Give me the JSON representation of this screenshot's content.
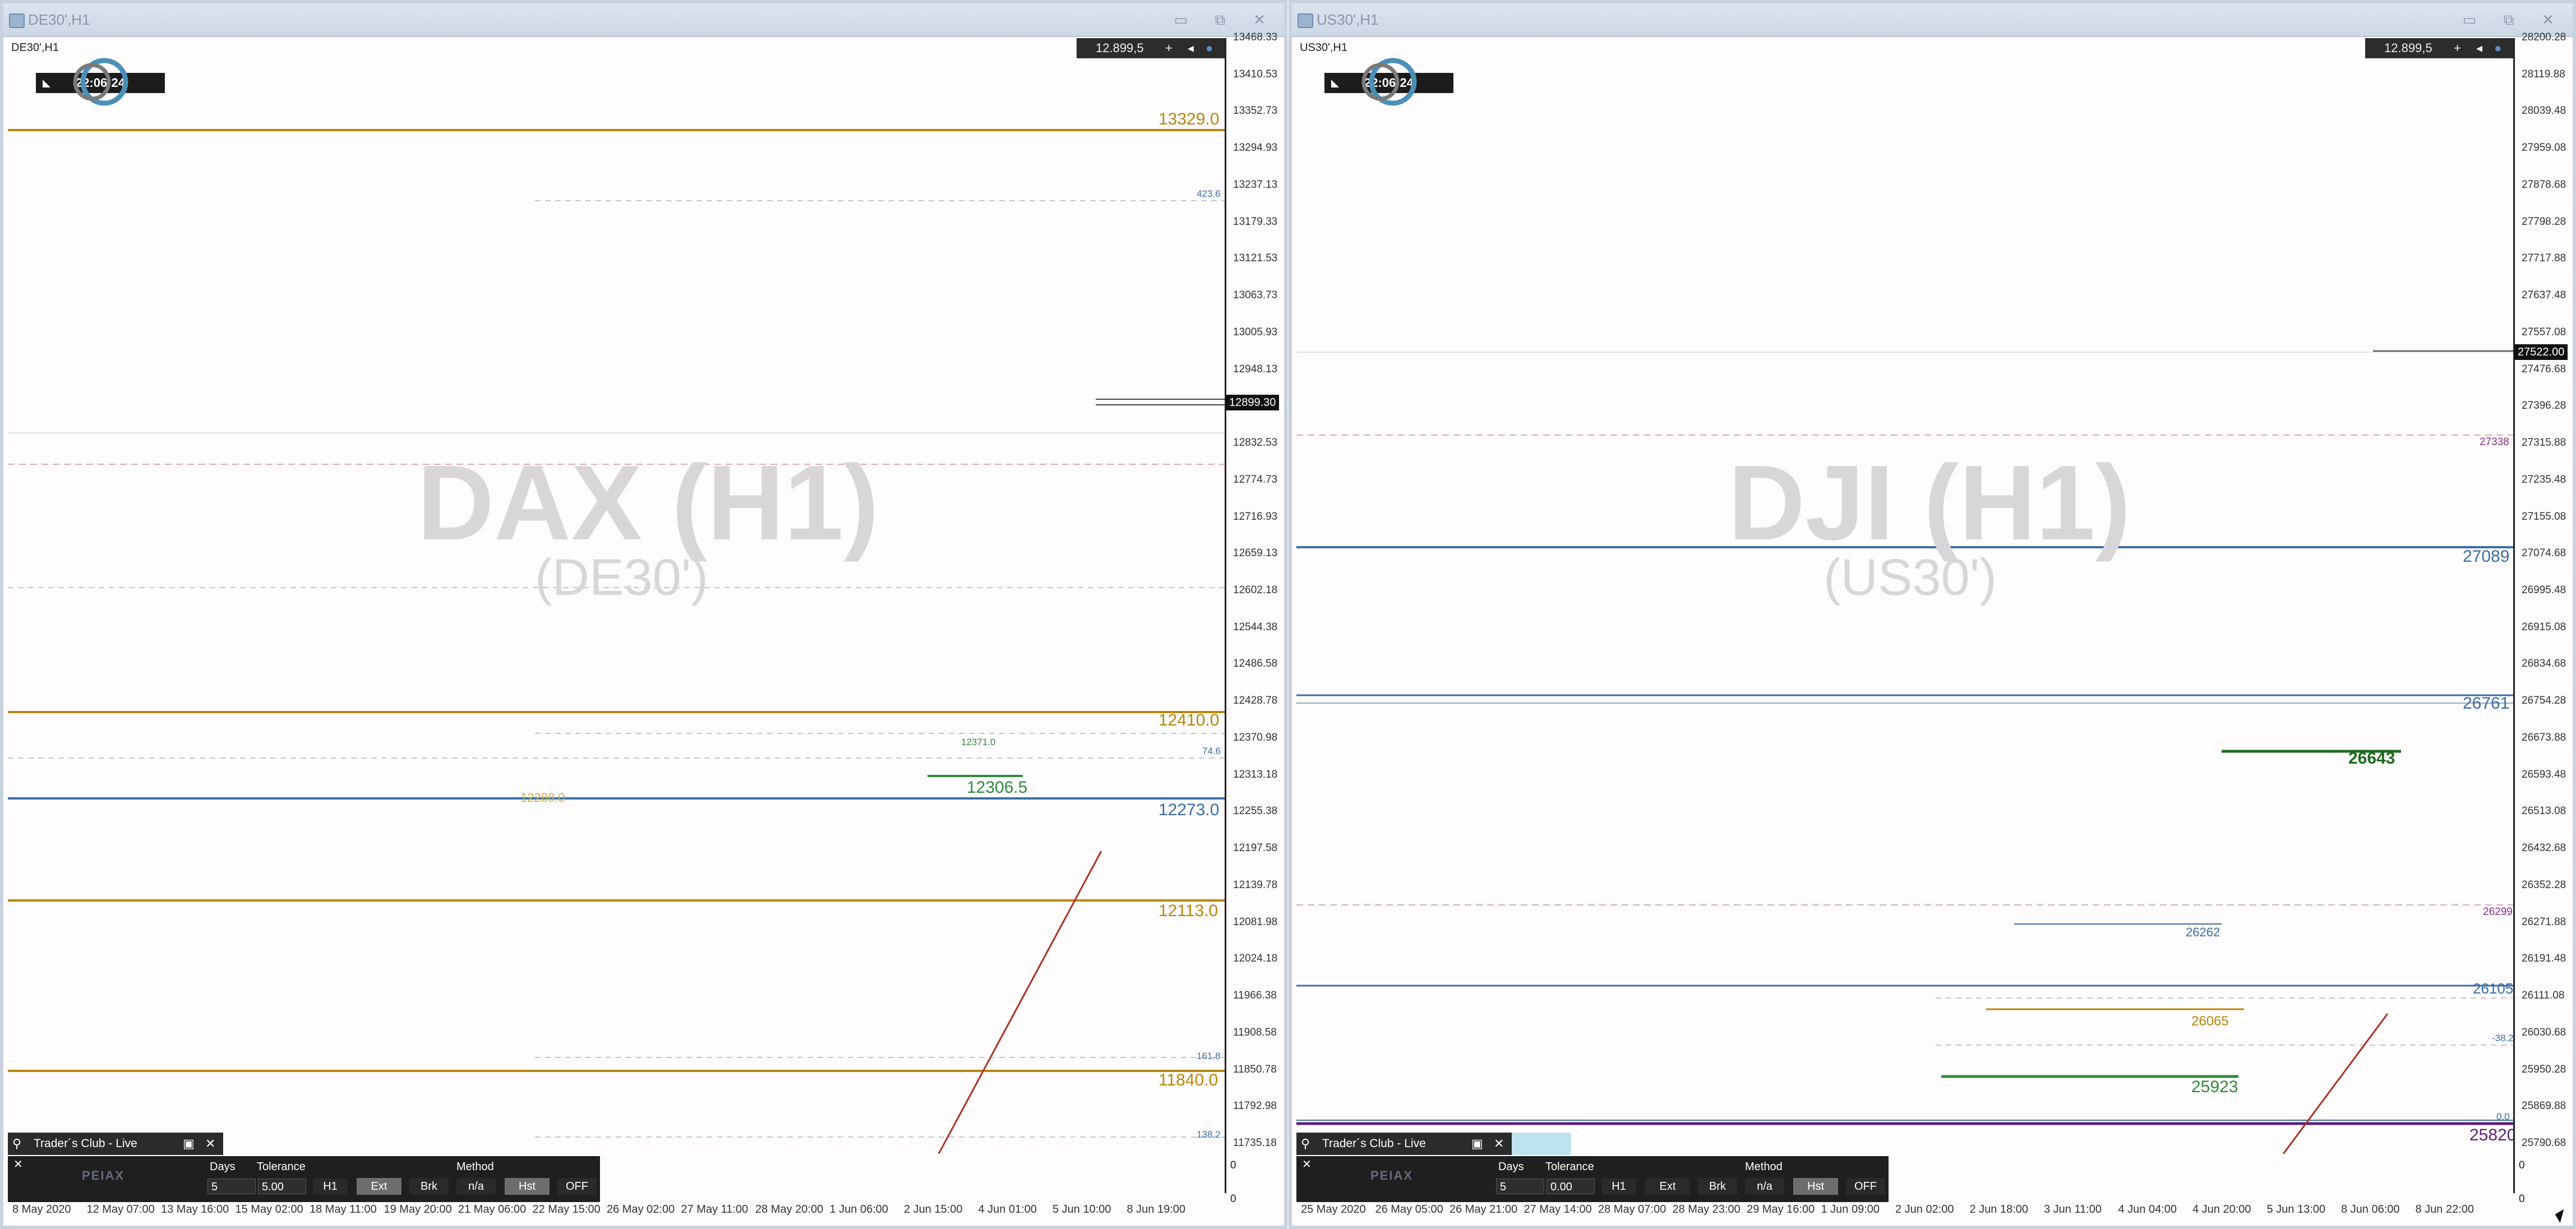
{
  "left": {
    "window_title": "DE30',H1",
    "symbol_label": "DE30',H1",
    "clock": "22:06:24",
    "top_price": "12.899,5",
    "watermark_main": "DAX (H1)",
    "watermark_sub": "(DE30')",
    "current_price": "12899.30",
    "y_ticks": [
      "13468.33",
      "13410.53",
      "13352.73",
      "13294.93",
      "13237.13",
      "13179.33",
      "13121.53",
      "13063.73",
      "13005.93",
      "12948.13",
      "12890.33",
      "12832.53",
      "12774.73",
      "12716.93",
      "12659.13",
      "12602.18",
      "12544.38",
      "12486.58",
      "12428.78",
      "12370.98",
      "12313.18",
      "12255.38",
      "12197.58",
      "12139.78",
      "12081.98",
      "12024.18",
      "11966.38",
      "11908.58",
      "11850.78",
      "11792.98",
      "11735.18"
    ],
    "levels": [
      {
        "label": "13329.0",
        "color": "#b8860b"
      },
      {
        "label": "12410.0",
        "color": "#b8860b"
      },
      {
        "label": "12306.5",
        "color": "#2e8b3e"
      },
      {
        "label": "12273.0",
        "color": "#3a6ea5"
      },
      {
        "label": "12113.0",
        "color": "#b8860b"
      },
      {
        "label": "11840.0",
        "color": "#b8860b"
      }
    ],
    "small_labels": [
      "423.6",
      "12371.0",
      "74.6",
      "12288.0",
      "161.8",
      "138.2"
    ],
    "x_labels": [
      "8 May 2020",
      "12 May 07:00",
      "13 May 16:00",
      "15 May 02:00",
      "18 May 11:00",
      "19 May 20:00",
      "21 May 06:00",
      "22 May 15:00",
      "26 May 02:00",
      "27 May 11:00",
      "28 May 20:00",
      "1 Jun 06:00",
      "2 Jun 15:00",
      "4 Jun 01:00",
      "5 Jun 10:00",
      "8 Jun 19:00"
    ],
    "zero_labels": [
      "0",
      "0"
    ]
  },
  "right": {
    "window_title": "US30',H1",
    "symbol_label": "US30',H1",
    "clock": "22:06:24",
    "top_price": "12.899,5",
    "watermark_main": "DJI (H1)",
    "watermark_sub": "(US30')",
    "current_price": "27522.00",
    "y_ticks": [
      "28200.28",
      "28119.88",
      "28039.48",
      "27959.08",
      "27878.68",
      "27798.28",
      "27717.88",
      "27637.48",
      "27557.08",
      "27476.68",
      "27396.28",
      "27315.88",
      "27235.48",
      "27155.08",
      "27074.68",
      "26995.48",
      "26915.08",
      "26834.68",
      "26754.28",
      "26673.88",
      "26593.48",
      "26513.08",
      "26432.68",
      "26352.28",
      "26271.88",
      "26191.48",
      "26111.08",
      "26030.68",
      "25950.28",
      "25869.88",
      "25790.68"
    ],
    "levels": [
      {
        "label": "27338",
        "color": "#8b2f7f"
      },
      {
        "label": "27089",
        "color": "#3a6ea5"
      },
      {
        "label": "26761",
        "color": "#3a6ea5"
      },
      {
        "label": "26643",
        "color": "#1f6b1f"
      },
      {
        "label": "26299",
        "color": "#8b2f7f"
      },
      {
        "label": "26262",
        "color": "#3a6ea5"
      },
      {
        "label": "26105",
        "color": "#3a6ea5"
      },
      {
        "label": "26065",
        "color": "#b8860b"
      },
      {
        "label": "25923",
        "color": "#2e8b3e"
      },
      {
        "label": "25820",
        "color": "#5a1f7a"
      }
    ],
    "small_labels": [
      "-38.2",
      "0.0"
    ],
    "x_labels": [
      "25 May 2020",
      "26 May 05:00",
      "26 May 21:00",
      "27 May 14:00",
      "28 May 07:00",
      "28 May 23:00",
      "29 May 16:00",
      "1 Jun 09:00",
      "2 Jun 02:00",
      "2 Jun 18:00",
      "3 Jun 11:00",
      "4 Jun 04:00",
      "4 Jun 20:00",
      "5 Jun 13:00",
      "8 Jun 06:00",
      "8 Jun 22:00"
    ],
    "zero_labels": [
      "0",
      "0"
    ]
  },
  "panel": {
    "title": "Trader´s Club - Live",
    "days_label": "Days",
    "tolerance_label": "Tolerance",
    "method_label": "Method",
    "left_days": "5",
    "left_tolerance": "5.00",
    "right_days": "5",
    "right_tolerance": "0.00",
    "buttons": [
      "H1",
      "Ext",
      "Brk",
      "n/a",
      "Hst",
      "OFF"
    ],
    "logo_text": "PEIAX"
  },
  "colors": {
    "gold": "#b8860b",
    "blue": "#3a6ea5",
    "green": "#2e8b3e",
    "dashed_pink": "#d9a9b6",
    "dashed_blue": "#b8c9d9",
    "trend_red": "#b03020"
  }
}
